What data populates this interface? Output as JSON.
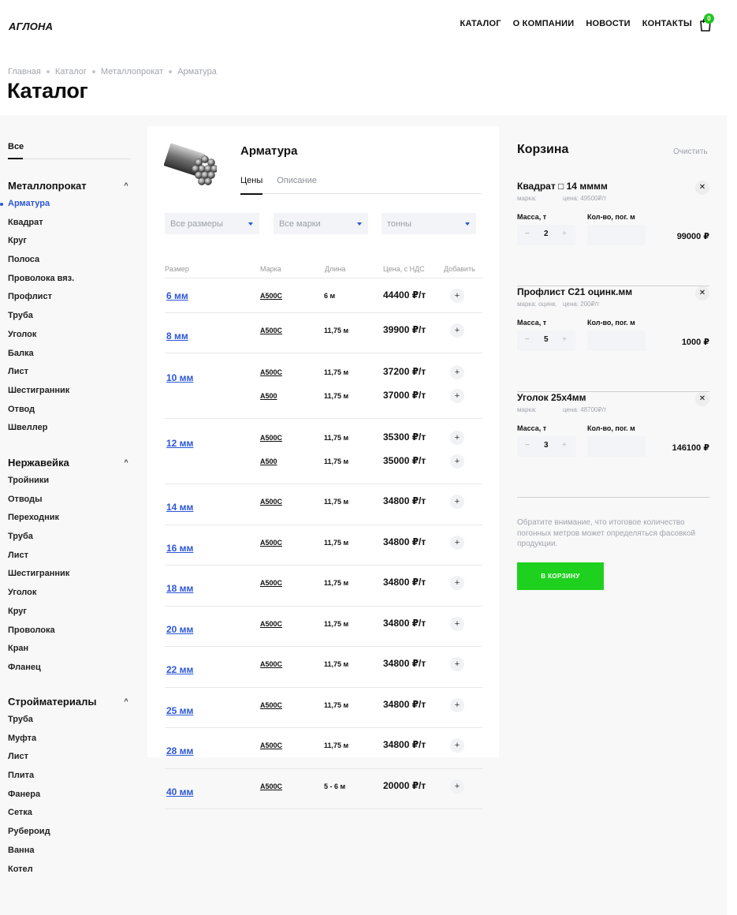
{
  "header": {
    "logo": "АГЛОНА",
    "nav": [
      "КАТАЛОГ",
      "О КОМПАНИИ",
      "НОВОСТИ",
      "КОНТАКТЫ"
    ],
    "cart_count": "0"
  },
  "breadcrumb": [
    "Главная",
    "Каталог",
    "Металлопрокат",
    "Арматура"
  ],
  "page_title": "Каталог",
  "sidebar": {
    "all_label": "Все",
    "groups": [
      {
        "title": "Металлопрокат",
        "items": [
          "Арматура",
          "Квадрат",
          "Круг",
          "Полоса",
          "Проволока вяз.",
          "Профлист",
          "Труба",
          "Уголок",
          "Балка",
          "Лист",
          "Шестигранник",
          "Отвод",
          "Швеллер"
        ]
      },
      {
        "title": "Нержавейка",
        "items": [
          "Тройники",
          "Отводы",
          "Переходник",
          "Труба",
          "Лист",
          "Шестигранник",
          "Уголок",
          "Круг",
          "Проволока",
          "Кран",
          "Фланец"
        ]
      },
      {
        "title": "Стройматериалы",
        "items": [
          "Труба",
          "Муфта",
          "Лист",
          "Плита",
          "Фанера",
          "Сетка",
          "Рубероид",
          "Ванна",
          "Котел"
        ]
      }
    ],
    "active_item": "Арматура"
  },
  "product": {
    "title": "Арматура",
    "tabs": [
      "Цены",
      "Описание"
    ],
    "filters": [
      "Все размеры",
      "Все марки",
      "тонны"
    ],
    "columns": [
      "Размер",
      "Марка",
      "Длина",
      "Цена, с НДС",
      "Добавить"
    ],
    "rows": [
      {
        "size": "6 мм",
        "variants": [
          {
            "mark": "А500С",
            "length": "6 м",
            "price": "44400 ₽/т"
          }
        ]
      },
      {
        "size": "8 мм",
        "variants": [
          {
            "mark": "А500С",
            "length": "11,75 м",
            "price": "39900 ₽/т"
          }
        ]
      },
      {
        "size": "10 мм",
        "variants": [
          {
            "mark": "А500С",
            "length": "11,75 м",
            "price": "37200 ₽/т"
          },
          {
            "mark": "А500",
            "length": "11,75 м",
            "price": "37000 ₽/т"
          }
        ]
      },
      {
        "size": "12 мм",
        "variants": [
          {
            "mark": "А500С",
            "length": "11,75 м",
            "price": "35300 ₽/т"
          },
          {
            "mark": "А500",
            "length": "11,75 м",
            "price": "35000 ₽/т"
          }
        ]
      },
      {
        "size": "14 мм",
        "variants": [
          {
            "mark": "А500С",
            "length": "11,75 м",
            "price": "34800 ₽/т"
          }
        ]
      },
      {
        "size": "16 мм",
        "variants": [
          {
            "mark": "А500С",
            "length": "11,75 м",
            "price": "34800 ₽/т"
          }
        ]
      },
      {
        "size": "18 мм",
        "variants": [
          {
            "mark": "А500С",
            "length": "11,75 м",
            "price": "34800 ₽/т"
          }
        ]
      },
      {
        "size": "20 мм",
        "variants": [
          {
            "mark": "А500С",
            "length": "11,75 м",
            "price": "34800 ₽/т"
          }
        ]
      },
      {
        "size": "22 мм",
        "variants": [
          {
            "mark": "А500С",
            "length": "11,75 м",
            "price": "34800 ₽/т"
          }
        ]
      },
      {
        "size": "25 мм",
        "variants": [
          {
            "mark": "А500С",
            "length": "11,75 м",
            "price": "34800 ₽/т"
          }
        ]
      },
      {
        "size": "28 мм",
        "variants": [
          {
            "mark": "А500С",
            "length": "11,75 м",
            "price": "34800 ₽/т"
          }
        ]
      },
      {
        "size": "40 мм",
        "variants": [
          {
            "mark": "А500С",
            "length": "5 - 6 м",
            "price": "20000 ₽/т"
          }
        ]
      }
    ],
    "add_symbol": "+"
  },
  "basket": {
    "title": "Корзина",
    "clear_label": "Очистить",
    "mass_label": "Масса, т",
    "meters_label": "Кол-во, пог. м",
    "items": [
      {
        "name": "Квадрат □ 14 мммм",
        "mark": "марка:",
        "price": "цена: 49500₽/т",
        "qty": "2",
        "total": "99000 ₽"
      },
      {
        "name": "Профлист С21 оцинк.мм",
        "mark": "марка: оцинк.",
        "price": "цена: 200₽/т",
        "qty": "5",
        "total": "1000 ₽"
      },
      {
        "name": "Уголок 25х4мм",
        "mark": "марка:",
        "price": "цена: 48700₽/т",
        "qty": "3",
        "total": "146100 ₽"
      }
    ],
    "note": "Обратите внимание, что итоговое количество погонных метров может определяться фасовкой продукции.",
    "button_label": "В КОРЗИНУ"
  }
}
